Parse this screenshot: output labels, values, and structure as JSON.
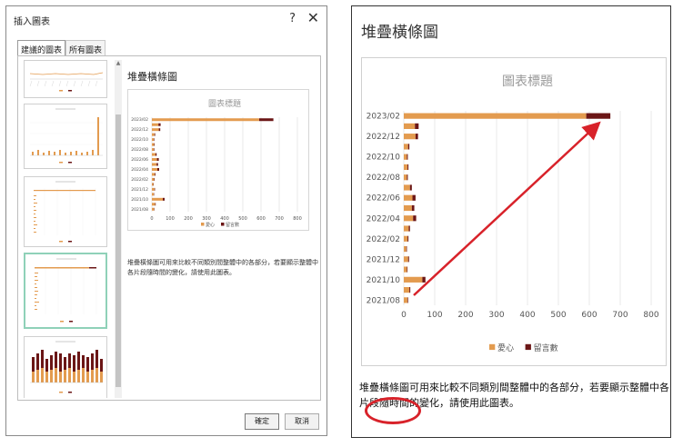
{
  "dialog": {
    "title": "插入圖表",
    "help_label": "?",
    "close_label": "✕",
    "tabs": [
      {
        "label": "建議的圖表",
        "active": true
      },
      {
        "label": "所有圖表",
        "active": false
      }
    ],
    "preview_title": "堆疊橫條圖",
    "description": "堆疊橫條圖可用來比較不同類別間整體中的各部分，若要顯示整體中各片段隨時間的變化，請使用此圖表。",
    "ok_label": "確定",
    "cancel_label": "取消"
  },
  "panel": {
    "title": "堆疊橫條圖",
    "description": "堆疊橫條圖可用來比較不同類別間整體中的各部分，若要顯示整體中各片段隨時間的變化，請使用此圖表。",
    "highlight_text": "隨時間的變化"
  },
  "colors": {
    "series1": "#e39b4f",
    "series2": "#6b1616",
    "annotation": "#d8222a",
    "selected_border": "#8fd1b8"
  },
  "chart_data": {
    "type": "bar",
    "orientation": "horizontal",
    "stacked": true,
    "title": "圖表標題",
    "categories": [
      "2021/08",
      "2021/09",
      "2021/10",
      "2021/11",
      "2021/12",
      "2022/01",
      "2022/02",
      "2022/03",
      "2022/04",
      "2022/05",
      "2022/06",
      "2022/07",
      "2022/08",
      "2022/09",
      "2022/10",
      "2022/11",
      "2022/12",
      "2023/01",
      "2023/02"
    ],
    "tick_labels": [
      "2021/08",
      "2021/10",
      "2021/12",
      "2022/02",
      "2022/04",
      "2022/06",
      "2022/08",
      "2022/10",
      "2022/12",
      "2023/02"
    ],
    "series": [
      {
        "name": "愛心",
        "values": [
          12,
          18,
          60,
          10,
          14,
          8,
          12,
          16,
          30,
          26,
          28,
          20,
          10,
          12,
          10,
          14,
          38,
          36,
          590
        ]
      },
      {
        "name": "留言數",
        "values": [
          2,
          3,
          10,
          2,
          3,
          2,
          3,
          4,
          10,
          8,
          10,
          6,
          3,
          3,
          3,
          4,
          8,
          12,
          78
        ]
      }
    ],
    "xlim": [
      0,
      800
    ],
    "x_ticks": [
      0,
      100,
      200,
      300,
      400,
      500,
      600,
      700,
      800
    ],
    "grid": true,
    "legend": "bottom"
  }
}
